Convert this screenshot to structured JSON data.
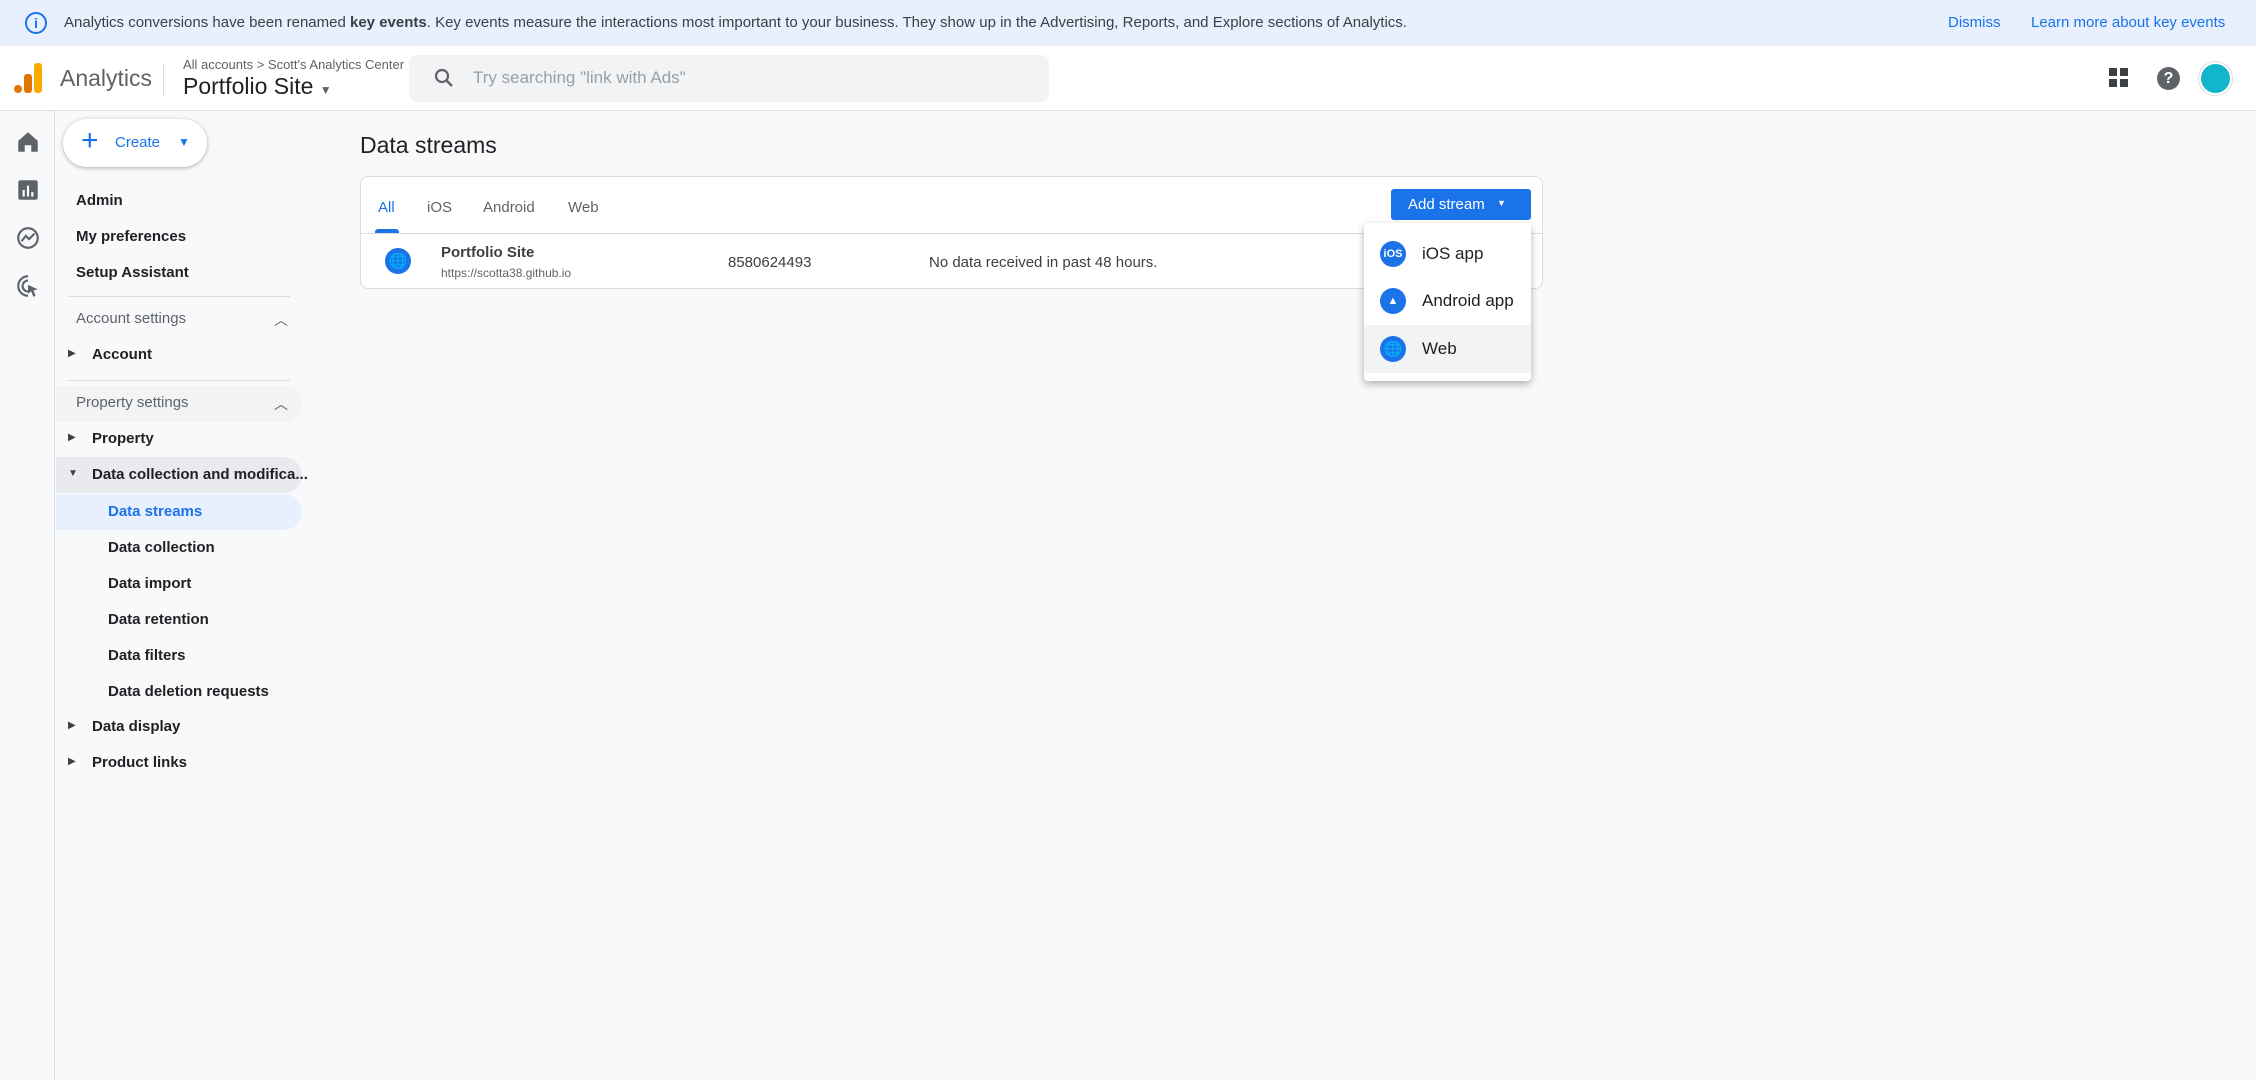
{
  "banner": {
    "pre": "Analytics conversions have been renamed ",
    "bold": "key events",
    "post": ". Key events measure the interactions most important to your business. They show up in the Advertising, Reports, and Explore sections of Analytics.",
    "dismiss": "Dismiss",
    "learn_more": "Learn more about key events"
  },
  "header": {
    "product": "Analytics",
    "breadcrumb": "All accounts > Scott's Analytics Center",
    "property": "Portfolio Site",
    "search_placeholder": "Try searching \"link with Ads\""
  },
  "nav": {
    "create": "Create",
    "admin": "Admin",
    "preferences": "My preferences",
    "setup": "Setup Assistant",
    "account_settings": "Account settings",
    "account": "Account",
    "property_settings": "Property settings",
    "property": "Property",
    "data_collection_mod": "Data collection and modifica...",
    "sub": [
      "Data streams",
      "Data collection",
      "Data import",
      "Data retention",
      "Data filters",
      "Data deletion requests"
    ],
    "data_display": "Data display",
    "product_links": "Product links"
  },
  "main": {
    "title": "Data streams",
    "tabs": [
      "All",
      "iOS",
      "Android",
      "Web"
    ],
    "active_tab": "All",
    "add_stream": "Add stream",
    "streams": [
      {
        "name": "Portfolio Site",
        "url": "https://scotta38.github.io",
        "id": "8580624493",
        "status": "No data received in past 48 hours."
      }
    ],
    "menu": [
      "iOS app",
      "Android app",
      "Web"
    ]
  },
  "colors": {
    "accent": "#1a73e8",
    "banner_bg": "#e8f0fe",
    "selected_bg": "#e8f0fe"
  }
}
